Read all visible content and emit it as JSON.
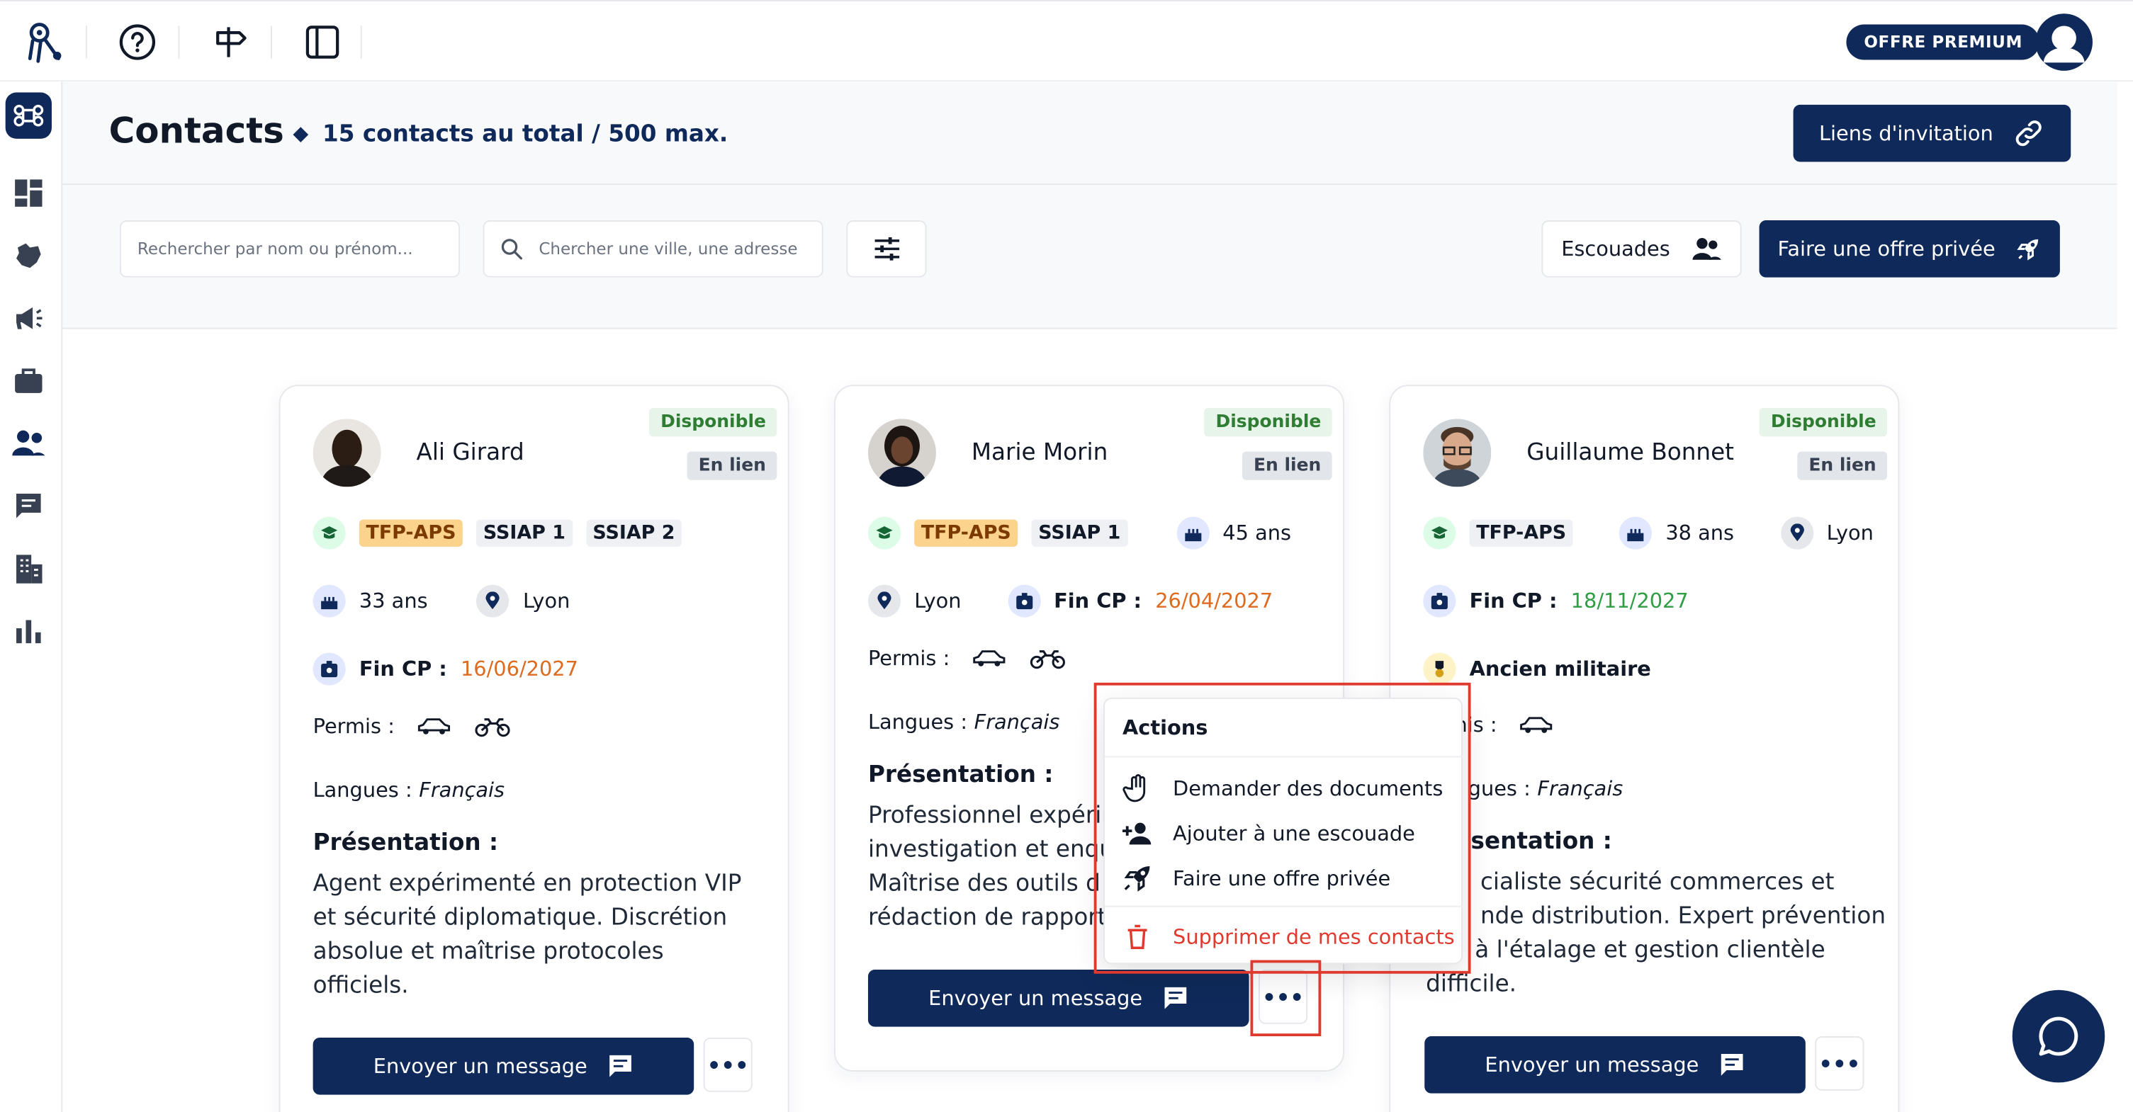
{
  "topbar": {
    "premium_label": "OFFRE PREMIUM",
    "icons": [
      "logo-icon",
      "help-icon",
      "signpost-icon",
      "panel-icon"
    ]
  },
  "sidebar": {
    "items": [
      "command-icon",
      "dashboard-icon",
      "map-icon",
      "megaphone-icon",
      "briefcase-icon",
      "contacts-icon",
      "chat-icon",
      "building-icon",
      "chart-icon"
    ]
  },
  "header": {
    "title": "Contacts",
    "count_text": "15 contacts au total / 500 max.",
    "invite_label": "Liens d'invitation"
  },
  "filters": {
    "name_placeholder": "Rechercher par nom ou prénom...",
    "city_placeholder": "Chercher une ville, une adresse",
    "squads_label": "Escouades",
    "offer_label": "Faire une offre privée"
  },
  "cards": [
    {
      "name": "Ali Girard",
      "status": "Disponible",
      "link": "En lien",
      "certs": [
        "TFP-APS",
        "SSIAP 1",
        "SSIAP 2"
      ],
      "age": "33 ans",
      "city": "Lyon",
      "cp_label": "Fin CP :",
      "cp_date": "16/06/2027",
      "permis_label": "Permis :",
      "langues_label": "Langues :",
      "langues": "Français",
      "pres_title": "Présentation :",
      "pres_lines": [
        "Agent expérimenté en protection VIP",
        "et sécurité diplomatique. Discrétion",
        "absolue et maîtrise protocoles",
        "officiels."
      ],
      "message_label": "Envoyer un message",
      "more": "•••"
    },
    {
      "name": "Marie Morin",
      "status": "Disponible",
      "link": "En lien",
      "certs": [
        "TFP-APS",
        "SSIAP 1"
      ],
      "age": "45 ans",
      "city": "Lyon",
      "cp_label": "Fin CP :",
      "cp_date": "26/04/2027",
      "permis_label": "Permis :",
      "langues_label": "Langues :",
      "langues": "Français",
      "pres_title": "Présentation :",
      "pres_lines": [
        "Professionnel expérir",
        "investigation et enqu",
        "Maîtrise des outils d",
        "rédaction de rapport"
      ],
      "message_label": "Envoyer un message",
      "more": "•••"
    },
    {
      "name": "Guillaume Bonnet",
      "status": "Disponible",
      "link": "En lien",
      "certs": [
        "TFP-APS"
      ],
      "age": "38 ans",
      "city": "Lyon",
      "cp_label": "Fin CP :",
      "cp_date": "18/11/2027",
      "military": "Ancien militaire",
      "permis_label": "nis :",
      "langues_label": "gues :",
      "langues": "Français",
      "pres_title": "sentation :",
      "pres_lines": [
        "cialiste sécurité commerces et",
        "nde distribution. Expert prévention",
        "à l'étalage et gestion clientèle",
        "difficile."
      ],
      "message_label": "Envoyer un message",
      "more": "•••"
    }
  ],
  "menu": {
    "title": "Actions",
    "items": [
      "Demander des documents",
      "Ajouter à une escouade",
      "Faire une offre privée"
    ],
    "delete": "Supprimer de mes contacts"
  },
  "colors": {
    "brand": "#0f2a5a",
    "danger": "#e03a2f",
    "available": "#2e7d32",
    "orange_date": "#dd6b20",
    "green_date": "#2f9e44"
  }
}
